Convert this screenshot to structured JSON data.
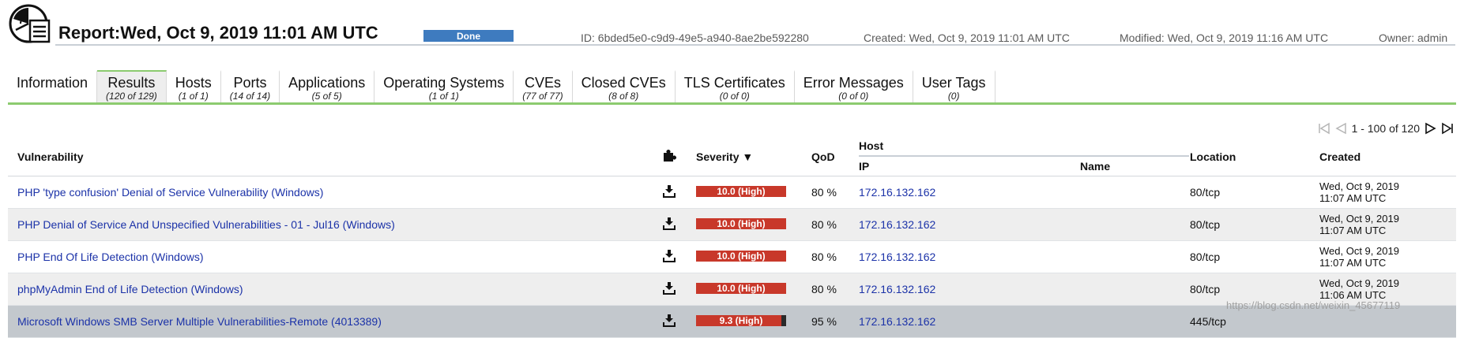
{
  "header": {
    "title": "Report:Wed, Oct 9, 2019 11:01 AM UTC",
    "status": "Done",
    "id": "ID: 6bded5e0-c9d9-49e5-a940-8ae2be592280",
    "created": "Created: Wed, Oct 9, 2019 11:01 AM UTC",
    "modified": "Modified: Wed, Oct 9, 2019 11:16 AM UTC",
    "owner": "Owner: admin",
    "status_color": "#3e7bbf"
  },
  "tabs": [
    {
      "label": "Information",
      "count": ""
    },
    {
      "label": "Results",
      "count": "(120 of 129)"
    },
    {
      "label": "Hosts",
      "count": "(1 of 1)"
    },
    {
      "label": "Ports",
      "count": "(14 of 14)"
    },
    {
      "label": "Applications",
      "count": "(5 of 5)"
    },
    {
      "label": "Operating Systems",
      "count": "(1 of 1)"
    },
    {
      "label": "CVEs",
      "count": "(77 of 77)"
    },
    {
      "label": "Closed CVEs",
      "count": "(8 of 8)"
    },
    {
      "label": "TLS Certificates",
      "count": "(0 of 0)"
    },
    {
      "label": "Error Messages",
      "count": "(0 of 0)"
    },
    {
      "label": "User Tags",
      "count": "(0)"
    }
  ],
  "active_tab": "Results",
  "pagination": {
    "text": "1 - 100 of 120",
    "icons": [
      "first-page-icon",
      "previous-page-icon",
      "next-page-icon",
      "last-page-icon"
    ]
  },
  "table": {
    "headers": {
      "vulnerability": "Vulnerability",
      "severity": "Severity",
      "sort_indicator": "▼",
      "qod": "QoD",
      "host": "Host",
      "ip": "IP",
      "name": "Name",
      "location": "Location",
      "created": "Created"
    },
    "header_icon": "puzzle-piece-icon",
    "rows": [
      {
        "vulnerability": "PHP 'type confusion' Denial of Service Vulnerability (Windows)",
        "severity": "10.0 (High)",
        "severity_fraction": 1.0,
        "qod": "80 %",
        "ip": "172.16.132.162",
        "name": "",
        "location": "80/tcp",
        "created_date": "Wed, Oct 9, 2019",
        "created_time": "11:07 AM UTC"
      },
      {
        "vulnerability": "PHP Denial of Service And Unspecified Vulnerabilities - 01 - Jul16 (Windows)",
        "severity": "10.0 (High)",
        "severity_fraction": 1.0,
        "qod": "80 %",
        "ip": "172.16.132.162",
        "name": "",
        "location": "80/tcp",
        "created_date": "Wed, Oct 9, 2019",
        "created_time": "11:07 AM UTC"
      },
      {
        "vulnerability": "PHP End Of Life Detection (Windows)",
        "severity": "10.0 (High)",
        "severity_fraction": 1.0,
        "qod": "80 %",
        "ip": "172.16.132.162",
        "name": "",
        "location": "80/tcp",
        "created_date": "Wed, Oct 9, 2019",
        "created_time": "11:07 AM UTC"
      },
      {
        "vulnerability": "phpMyAdmin End of Life Detection (Windows)",
        "severity": "10.0 (High)",
        "severity_fraction": 1.0,
        "qod": "80 %",
        "ip": "172.16.132.162",
        "name": "",
        "location": "80/tcp",
        "created_date": "Wed, Oct 9, 2019",
        "created_time": "11:06 AM UTC"
      },
      {
        "vulnerability": "Microsoft Windows SMB Server Multiple Vulnerabilities-Remote (4013389)",
        "severity": "9.3 (High)",
        "severity_fraction": 0.93,
        "qod": "95 %",
        "ip": "172.16.132.162",
        "name": "",
        "location": "445/tcp",
        "created_date": "",
        "created_time": ""
      }
    ],
    "row_icon": "download-note-icon",
    "severity_color": "#c8382a"
  },
  "watermark": "https://blog.csdn.net/weixin_45677119"
}
